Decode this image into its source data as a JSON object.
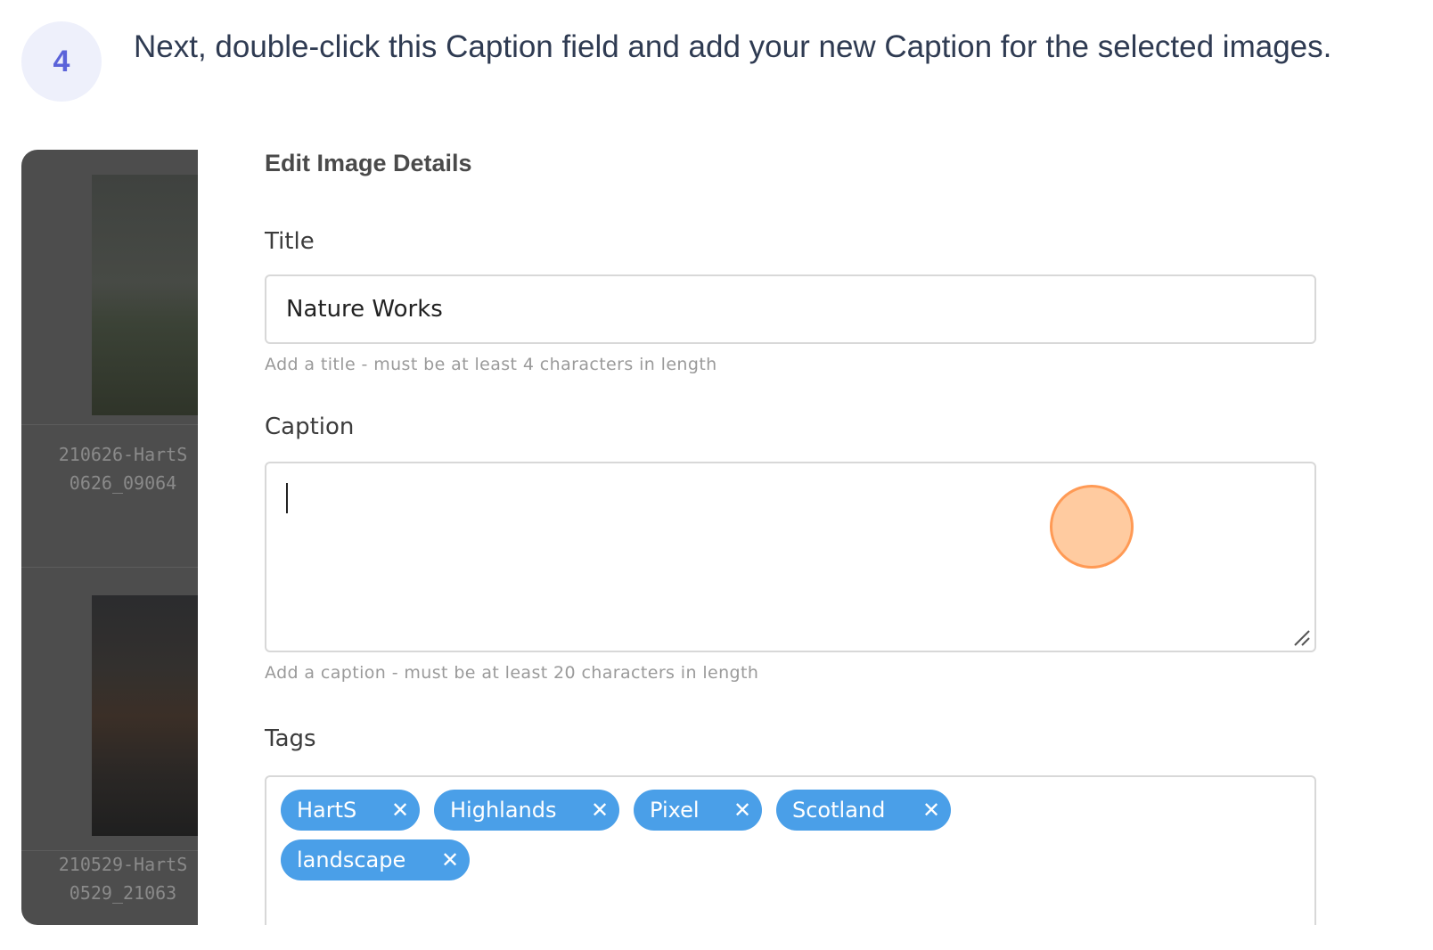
{
  "step": {
    "number": "4",
    "instruction": "Next, double-click this Caption field and add your new Caption for the selected images."
  },
  "left_panel": {
    "files": [
      {
        "line1": "210626-HartS",
        "line2": "0626_09064"
      },
      {
        "line1": "210529-HartS",
        "line2": "0529_21063"
      }
    ]
  },
  "modal": {
    "title": "Edit Image Details",
    "title_field": {
      "label": "Title",
      "value": "Nature Works",
      "help": "Add a title - must be at least 4 characters in length"
    },
    "caption_field": {
      "label": "Caption",
      "value": "",
      "help": "Add a caption - must be at least 20 characters in length"
    },
    "tags_field": {
      "label": "Tags",
      "tags": [
        "HartS",
        "Highlands",
        "Pixel",
        "Scotland",
        "landscape"
      ],
      "remove_icon": "close-icon"
    }
  },
  "colors": {
    "tag_bg": "#4a9fe8",
    "badge_bg": "#eef0fb",
    "badge_fg": "#5b63d9",
    "click_indicator": "#ffcba0"
  }
}
